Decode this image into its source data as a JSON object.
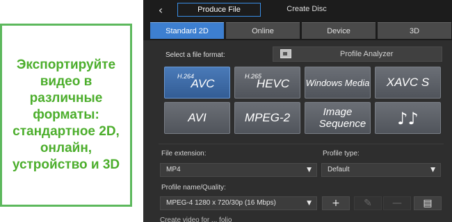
{
  "callout": {
    "text": "Экспортируйте видео в различные форматы: стандартное 2D, онлайн, устройство и 3D"
  },
  "topbar": {
    "back_icon": "‹",
    "tabs": [
      {
        "label": "Produce File",
        "active": true
      },
      {
        "label": "Create Disc",
        "active": false
      }
    ]
  },
  "subtabs": [
    {
      "label": "Standard 2D",
      "active": true
    },
    {
      "label": "Online",
      "active": false
    },
    {
      "label": "Device",
      "active": false
    },
    {
      "label": "3D",
      "active": false
    }
  ],
  "format_section": {
    "label": "Select a file format:",
    "analyzer_label": "Profile Analyzer",
    "analyzer_icon": "profile-analyzer-icon"
  },
  "formats": {
    "avc": {
      "sup": "H.264",
      "main": "AVC",
      "active": true
    },
    "hevc": {
      "sup": "H.265",
      "main": "HEVC"
    },
    "wmv": {
      "main": "Windows Media"
    },
    "xavc": {
      "main": "XAVC S"
    },
    "avi": {
      "main": "AVI"
    },
    "mpeg2": {
      "main": "MPEG-2"
    },
    "image_seq": {
      "line1": "Image",
      "line2": "Sequence"
    },
    "audio": {
      "icon": "♪♪"
    }
  },
  "settings": {
    "file_extension_label": "File extension:",
    "file_extension_value": "MP4",
    "profile_type_label": "Profile type:",
    "profile_type_value": "Default",
    "profile_name_label": "Profile name/Quality:",
    "profile_name_value": "MPEG-4 1280 x 720/30p (16 Mbps)",
    "add_icon": "+",
    "edit_icon": "✎",
    "remove_icon": "—",
    "details_icon": "▤",
    "bottom_text": "Create video for ... folio"
  }
}
